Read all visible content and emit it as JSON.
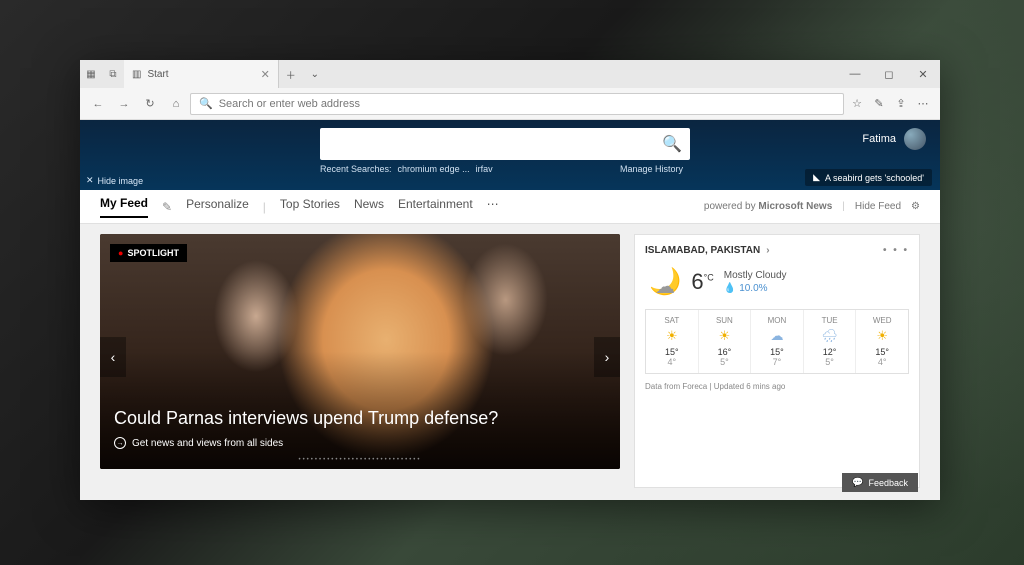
{
  "tab": {
    "title": "Start"
  },
  "address": {
    "placeholder": "Search or enter web address"
  },
  "hero": {
    "recent_label": "Recent Searches:",
    "recent_1": "chromium edge ...",
    "recent_2": "irfav",
    "manage": "Manage History",
    "hide_image": "Hide image",
    "user_name": "Fatima",
    "bing_caption": "A seabird gets 'schooled'"
  },
  "feednav": {
    "my_feed": "My Feed",
    "personalize": "Personalize",
    "top_stories": "Top Stories",
    "news": "News",
    "entertainment": "Entertainment",
    "powered_prefix": "powered by ",
    "powered_brand": "Microsoft News",
    "hide_feed": "Hide Feed"
  },
  "spotlight": {
    "badge": "SPOTLIGHT",
    "headline": "Could Parnas interviews upend Trump defense?",
    "subline": "Get news and views from all sides"
  },
  "weather": {
    "location": "ISLAMABAD, PAKISTAN",
    "temp": "6",
    "unit": "°C",
    "condition": "Mostly Cloudy",
    "precip": "10.0%",
    "days": [
      {
        "name": "SAT",
        "icon": "sun",
        "hi": "15°",
        "lo": "4°"
      },
      {
        "name": "SUN",
        "icon": "sun",
        "hi": "16°",
        "lo": "5°"
      },
      {
        "name": "MON",
        "icon": "cloud",
        "hi": "15°",
        "lo": "7°"
      },
      {
        "name": "TUE",
        "icon": "rain",
        "hi": "12°",
        "lo": "5°"
      },
      {
        "name": "WED",
        "icon": "sun",
        "hi": "15°",
        "lo": "4°"
      }
    ],
    "footer": "Data from Foreca | Updated 6 mins ago"
  },
  "feedback": "Feedback"
}
